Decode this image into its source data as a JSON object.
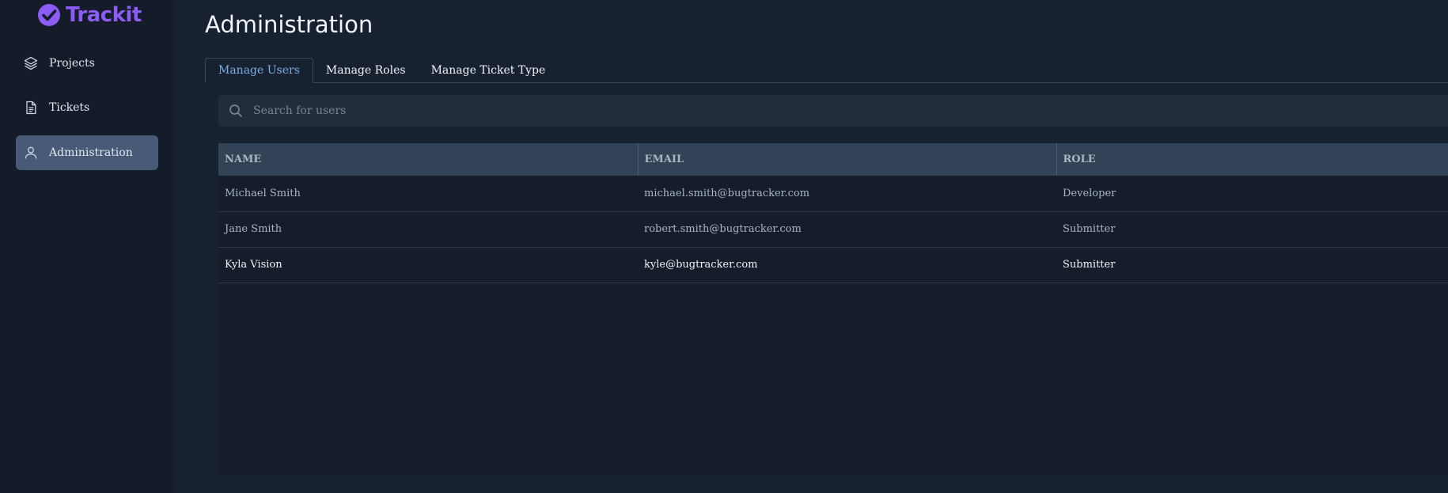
{
  "app": {
    "name": "Trackit",
    "brand_color": "#8b5cf6"
  },
  "sidebar": {
    "items": [
      {
        "label": "Projects",
        "icon": "layers-icon",
        "active": false
      },
      {
        "label": "Tickets",
        "icon": "document-icon",
        "active": false
      },
      {
        "label": "Administration",
        "icon": "user-icon",
        "active": true
      }
    ]
  },
  "page": {
    "title": "Administration"
  },
  "tabs": [
    {
      "label": "Manage Users",
      "active": true
    },
    {
      "label": "Manage Roles",
      "active": false
    },
    {
      "label": "Manage Ticket Type",
      "active": false
    }
  ],
  "search": {
    "placeholder": "Search for users",
    "value": ""
  },
  "table": {
    "columns": [
      "NAME",
      "EMAIL",
      "ROLE"
    ],
    "rows": [
      {
        "name": "Michael Smith",
        "email": "michael.smith@bugtracker.com",
        "role": "Developer"
      },
      {
        "name": "Jane Smith",
        "email": "robert.smith@bugtracker.com",
        "role": "Submitter"
      },
      {
        "name": "Kyla Vision",
        "email": "kyle@bugtracker.com",
        "role": "Submitter"
      }
    ]
  }
}
